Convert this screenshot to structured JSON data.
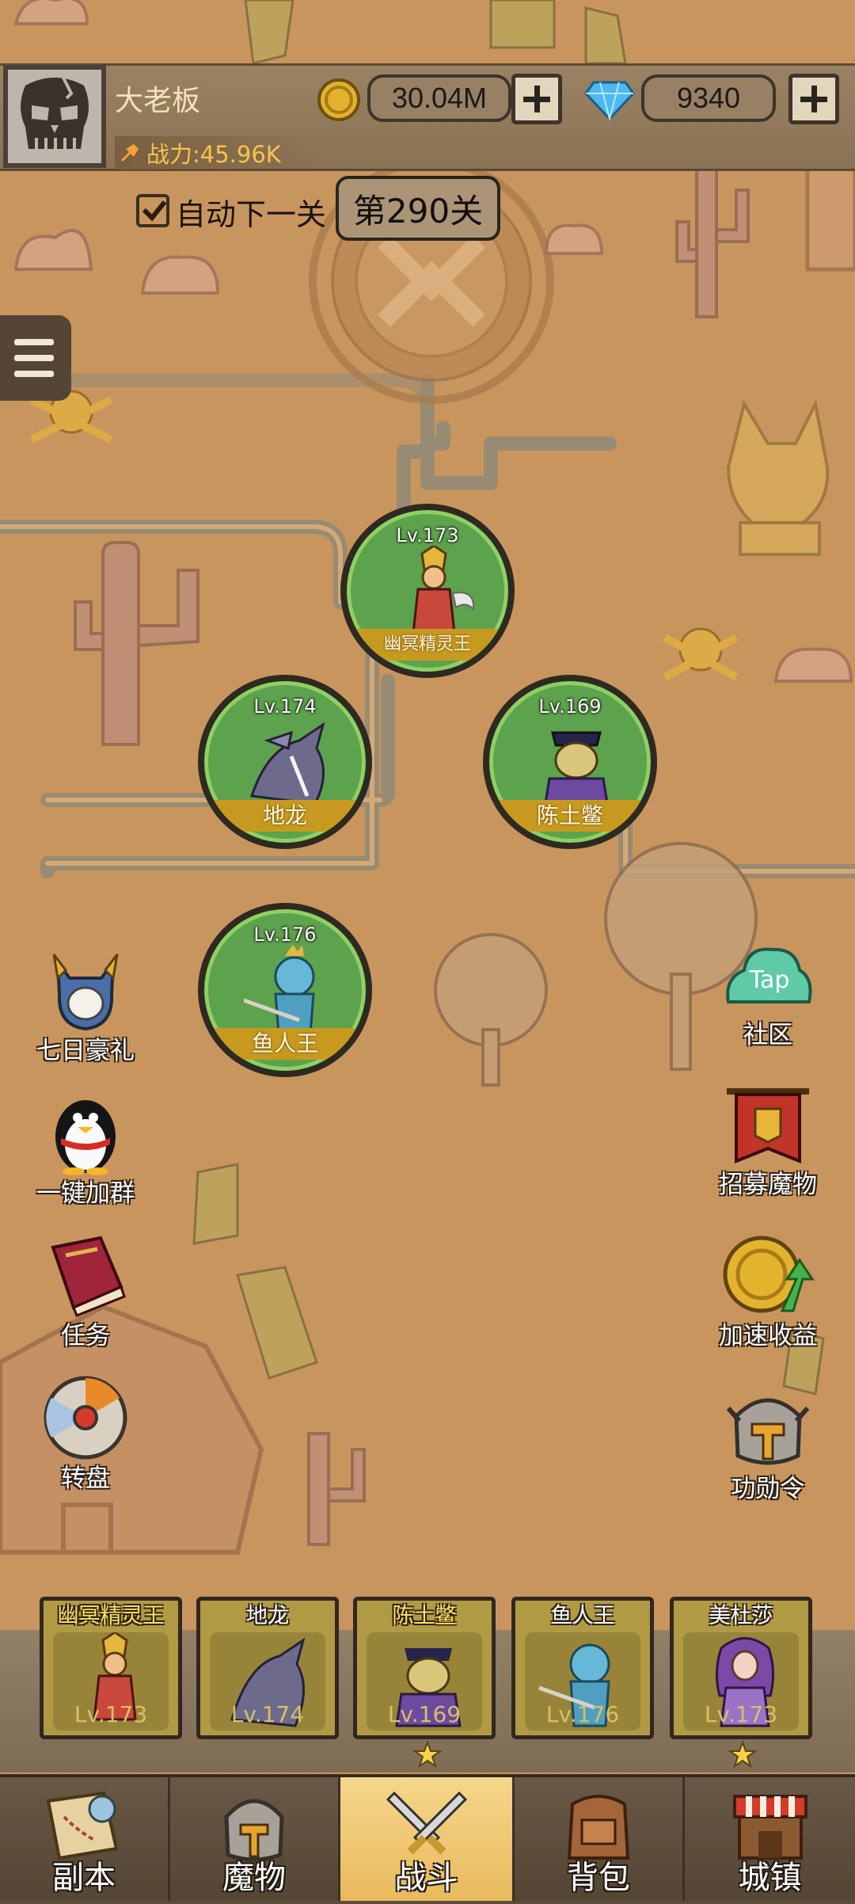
{
  "player": {
    "name": "大老板",
    "power": "战力:45.96K"
  },
  "currency": {
    "gold": "30.04M",
    "gems": "9340"
  },
  "stage": {
    "auto_next_label": "自动下一关",
    "auto_next_checked": true,
    "current": "第290关"
  },
  "map_monsters": [
    {
      "level": "Lv.173",
      "name": "幽冥精灵王"
    },
    {
      "level": "Lv.174",
      "name": "地龙"
    },
    {
      "level": "Lv.169",
      "name": "陈土鳖"
    },
    {
      "level": "Lv.176",
      "name": "鱼人王"
    }
  ],
  "left_menu": [
    {
      "label": "七日豪礼",
      "icon": "knight-helmet-icon"
    },
    {
      "label": "一键加群",
      "icon": "penguin-icon"
    },
    {
      "label": "任务",
      "icon": "quest-book-icon"
    },
    {
      "label": "转盘",
      "icon": "spin-wheel-icon"
    }
  ],
  "right_menu": [
    {
      "label": "社区",
      "icon": "taptap-icon",
      "badge": "Tap"
    },
    {
      "label": "招募魔物",
      "icon": "recruit-banner-icon"
    },
    {
      "label": "加速收益",
      "icon": "speed-coin-icon"
    },
    {
      "label": "功勋令",
      "icon": "merit-helmet-icon"
    }
  ],
  "team": [
    {
      "name": "幽冥精灵王",
      "level": "Lv.173",
      "star": false
    },
    {
      "name": "地龙",
      "level": "Lv.174",
      "star": false
    },
    {
      "name": "陈土鳖",
      "level": "Lv.169",
      "star": true
    },
    {
      "name": "鱼人王",
      "level": "Lv.176",
      "star": false
    },
    {
      "name": "美杜莎",
      "level": "Lv.173",
      "star": true
    }
  ],
  "nav": [
    {
      "label": "副本",
      "icon": "map-scroll-icon",
      "active": false
    },
    {
      "label": "魔物",
      "icon": "monster-helmet-icon",
      "active": false
    },
    {
      "label": "战斗",
      "icon": "crossed-swords-icon",
      "active": true
    },
    {
      "label": "背包",
      "icon": "backpack-icon",
      "active": false
    },
    {
      "label": "城镇",
      "icon": "shop-icon",
      "active": false
    }
  ],
  "colors": {
    "map": "#c9955e",
    "monster_ring": "#5da24d",
    "name_band": "#c79a1f",
    "active_tab": "#f5d68c"
  }
}
